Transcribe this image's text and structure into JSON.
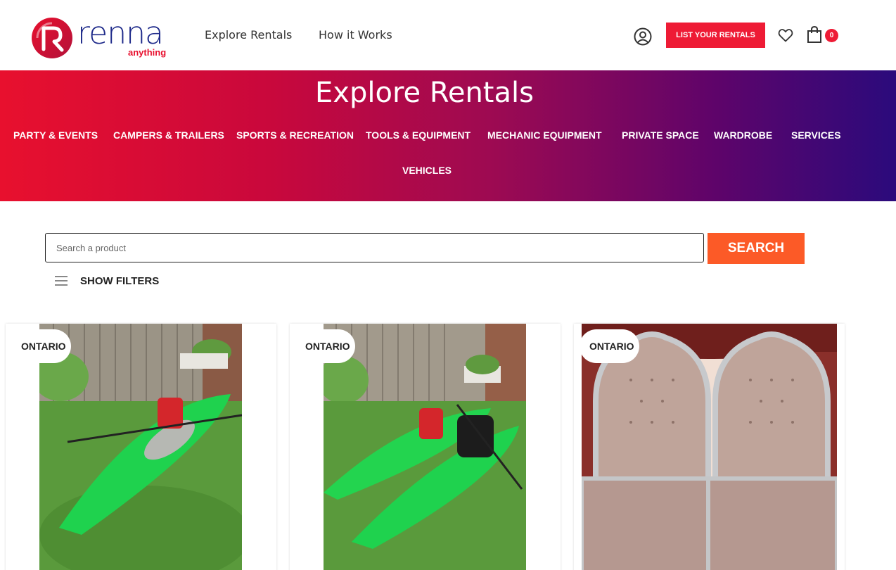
{
  "brand": {
    "name": "renna",
    "tagline": "anything",
    "colors": {
      "primary_red": "#ee1b35",
      "navy": "#1e2a8a",
      "search_orange": "#fc5a27",
      "gradient_start": "#e8102e",
      "gradient_end": "#2b0a7c"
    }
  },
  "header": {
    "nav": [
      {
        "label": "Explore Rentals"
      },
      {
        "label": "How it Works"
      }
    ],
    "account_icon": "user-circle-icon",
    "list_button": "LIST YOUR RENTALS",
    "wishlist_icon": "heart-icon",
    "cart_icon": "shopping-bag-icon",
    "cart_count": "0"
  },
  "hero": {
    "title": "Explore Rentals",
    "categories": [
      "PARTY & EVENTS",
      "CAMPERS & TRAILERS",
      "SPORTS & RECREATION",
      "TOOLS & EQUIPMENT",
      "MECHANIC EQUIPMENT",
      "PRIVATE SPACE",
      "WARDROBE",
      "SERVICES",
      "VEHICLES"
    ]
  },
  "search": {
    "placeholder": "Search a product",
    "value": "",
    "button": "SEARCH"
  },
  "filters": {
    "label": "SHOW FILTERS",
    "icon": "hamburger-icon"
  },
  "products": [
    {
      "region": "ONTARIO",
      "image": "single green kayak with red life jacket on grass"
    },
    {
      "region": "ONTARIO",
      "image": "two green kayaks with paddle and life jacket on grass"
    },
    {
      "region": "ONTARIO",
      "image": "pair of tufted throne chairs in front of curtains"
    }
  ]
}
